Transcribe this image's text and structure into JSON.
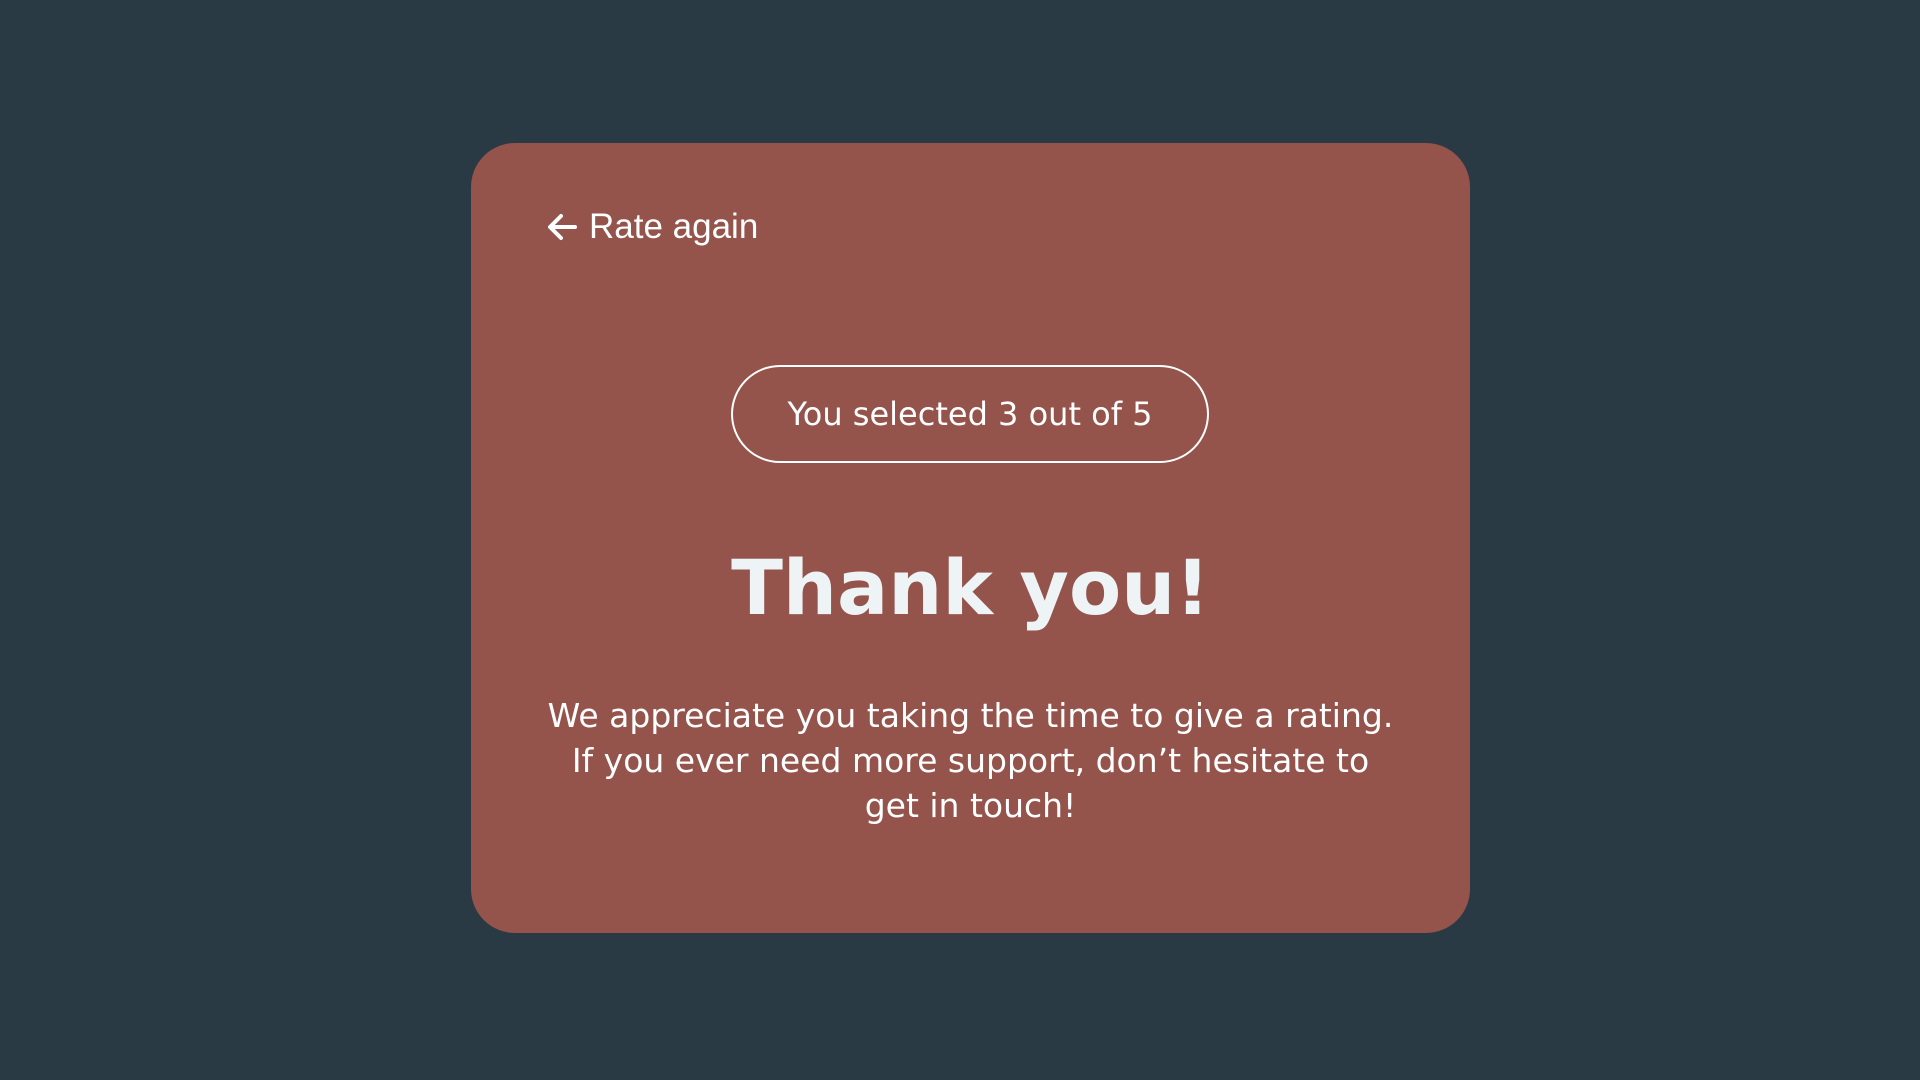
{
  "back_link": {
    "label": "Rate again",
    "icon": "arrow-left-icon"
  },
  "rating": {
    "selected_text": "You selected 3 out of 5",
    "selected": 3,
    "max": 5
  },
  "title": "Thank you!",
  "message": "We appreciate you taking the time to give a rating. If you ever need more support, don’t hesitate to get in touch!",
  "colors": {
    "background": "#2a3a44",
    "card": "#94534b",
    "text": "#ffffff",
    "title_text": "#eef4f6"
  }
}
